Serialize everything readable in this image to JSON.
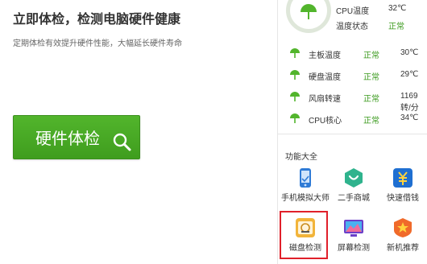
{
  "main": {
    "headline": "立即体检，检测电脑硬件健康",
    "subline": "定期体检有效提升硬件性能，大幅延长硬件寿命",
    "check_button_label": "硬件体检"
  },
  "status": {
    "cpu_temp_label": "CPU温度",
    "cpu_temp_value": "32℃",
    "temp_state_label": "温度状态",
    "temp_state_value": "正常"
  },
  "readings": [
    {
      "label": "主板温度",
      "status": "正常",
      "value": "30℃"
    },
    {
      "label": "硬盘温度",
      "status": "正常",
      "value": "29℃"
    },
    {
      "label": "风扇转速",
      "status": "正常",
      "value": "1169转/分"
    },
    {
      "label": "CPU核心",
      "status": "正常",
      "value": "34℃"
    }
  ],
  "features": {
    "title": "功能大全",
    "items": [
      {
        "label": "手机模拟大师",
        "icon": "phone-emulator-icon"
      },
      {
        "label": "二手商城",
        "icon": "second-hand-market-icon"
      },
      {
        "label": "快速借钱",
        "icon": "quick-loan-icon"
      },
      {
        "label": "磁盘检测",
        "icon": "disk-check-icon"
      },
      {
        "label": "屏幕检测",
        "icon": "screen-check-icon"
      },
      {
        "label": "新机推荐",
        "icon": "new-device-icon"
      }
    ]
  },
  "colors": {
    "accent_green": "#46a823",
    "status_green": "#3a9a1c",
    "highlight_red": "#e0202a"
  }
}
